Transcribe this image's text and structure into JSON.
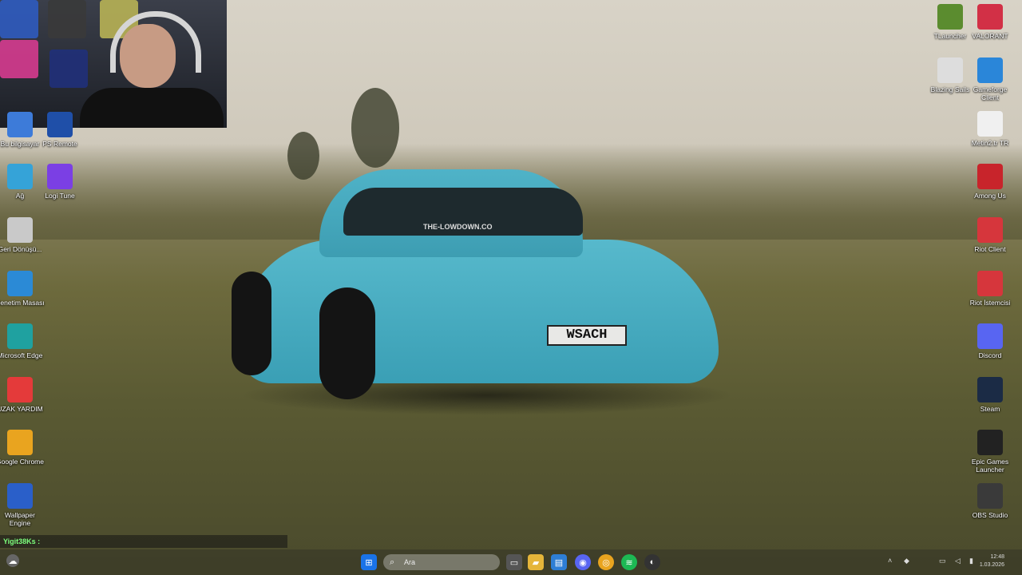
{
  "desktop": {
    "left_icons": [
      {
        "label": "Bu bilgisayar",
        "icon": "computer-icon",
        "color": "#3d7bd9"
      },
      {
        "label": "PS Remote",
        "icon": "ps-remote-icon",
        "color": "#1f4fa8"
      },
      {
        "label": "Ağ",
        "icon": "network-icon",
        "color": "#35a3d8"
      },
      {
        "label": "Logi Tune",
        "icon": "logi-tune-icon",
        "color": "#7b3fe4"
      },
      {
        "label": "Geri Dönüşü...",
        "icon": "recycle-bin-icon",
        "color": "#c9c9c9"
      },
      {
        "label": "Denetim Masası",
        "icon": "control-panel-icon",
        "color": "#2b8ad6"
      },
      {
        "label": "Microsoft Edge",
        "icon": "edge-icon",
        "color": "#1fa1a0"
      },
      {
        "label": "UZAK YARDIM",
        "icon": "remote-help-icon",
        "color": "#e43a3a"
      },
      {
        "label": "Google Chrome",
        "icon": "chrome-icon",
        "color": "#e9a41f"
      },
      {
        "label": "Wallpaper Engine",
        "icon": "wallpaper-engine-icon",
        "color": "#2a5fc9"
      }
    ],
    "right_icons": [
      {
        "label": "TLauncher",
        "icon": "tlauncher-icon",
        "color": "#5b8c2f"
      },
      {
        "label": "VALORANT",
        "icon": "valorant-icon",
        "color": "#d23046"
      },
      {
        "label": "Blazing Sails",
        "icon": "blazing-sails-icon",
        "color": "#dddddd"
      },
      {
        "label": "Gameforge Client",
        "icon": "gameforge-icon",
        "color": "#2a86d9"
      },
      {
        "label": "Metin2.tr TR",
        "icon": "file-icon",
        "color": "#f0f0f0"
      },
      {
        "label": "Among Us",
        "icon": "among-us-icon",
        "color": "#c8242b"
      },
      {
        "label": "Riot Client",
        "icon": "riot-client-icon",
        "color": "#d6363c"
      },
      {
        "label": "Riot İstemcisi",
        "icon": "riot-istemcisi-icon",
        "color": "#d6363c"
      },
      {
        "label": "Discord",
        "icon": "discord-icon",
        "color": "#5865f2"
      },
      {
        "label": "Steam",
        "icon": "steam-icon",
        "color": "#1b2b45"
      },
      {
        "label": "Epic Games Launcher",
        "icon": "epic-games-icon",
        "color": "#222222"
      },
      {
        "label": "OBS Studio",
        "icon": "obs-icon",
        "color": "#3a3a3a"
      }
    ],
    "wallpaper_plate": "WSACH",
    "wallpaper_sticker": "THE-LOWDOWN.CO"
  },
  "chat": {
    "username": "Yigit38Ks :"
  },
  "taskbar": {
    "search_placeholder": "Ara",
    "apps": [
      "start-icon",
      "task-view-icon",
      "file-explorer-icon",
      "store-icon",
      "discord-icon",
      "chrome-icon",
      "spotify-icon",
      "obs-icon"
    ],
    "clock_time": "12:48",
    "clock_date": "1.03.2026"
  }
}
